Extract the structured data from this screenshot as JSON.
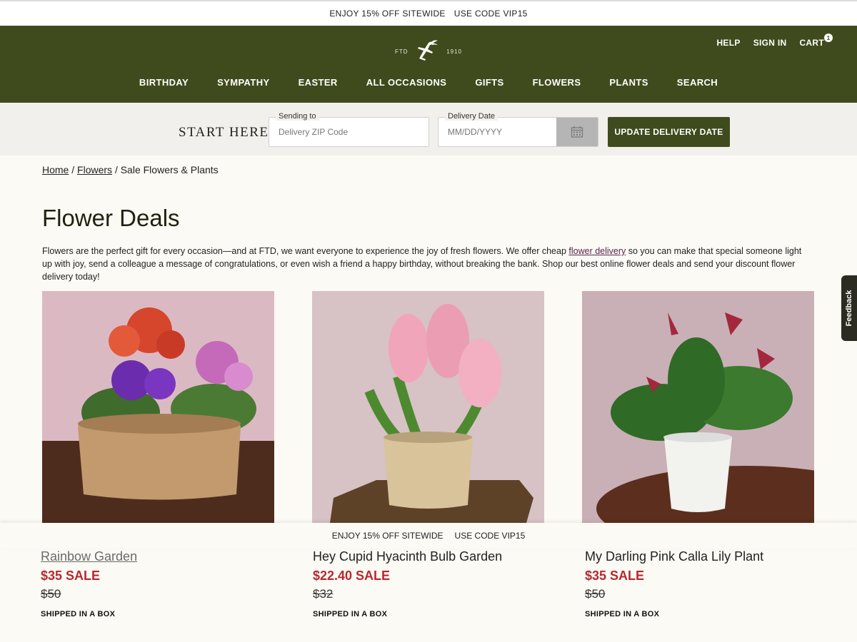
{
  "promo": {
    "text": "ENJOY 15% OFF SITEWIDE",
    "code": "USE CODE  VIP15"
  },
  "logo": {
    "left": "FTD",
    "right": "1910"
  },
  "utility": {
    "help": "HELP",
    "sign_in": "SIGN IN",
    "cart": "CART",
    "cart_count": "1"
  },
  "nav": [
    "BIRTHDAY",
    "SYMPATHY",
    "EASTER",
    "ALL OCCASIONS",
    "GIFTS",
    "FLOWERS",
    "PLANTS",
    "SEARCH"
  ],
  "delivery": {
    "start": "START HERE",
    "zip_label": "Sending to",
    "zip_placeholder": "Delivery ZIP Code",
    "date_label": "Delivery Date",
    "date_placeholder": "MM/DD/YYYY",
    "button": "UPDATE DELIVERY DATE"
  },
  "breadcrumb": {
    "home": "Home",
    "flowers": "Flowers",
    "current": "Sale Flowers & Plants",
    "sep": "/"
  },
  "page": {
    "title": "Flower Deals",
    "intro_before": "Flowers are the perfect gift for every occasion—and at FTD, we want everyone to experience the joy of fresh flowers. We offer cheap ",
    "intro_link": "flower delivery",
    "intro_after": " so you can make that special someone light up with joy, send a colleague a message of congratulations, or even wish a friend a happy birthday, without breaking the bank. Shop our best online flower deals and send your discount flower delivery today!"
  },
  "products": [
    {
      "name": "Rainbow Garden",
      "sale": "$35 SALE",
      "original": "$50",
      "shipping": "SHIPPED IN A BOX"
    },
    {
      "name": "Hey Cupid Hyacinth Bulb Garden",
      "sale": "$22.40 SALE",
      "original": "$32",
      "shipping": "SHIPPED IN A BOX"
    },
    {
      "name": "My Darling Pink Calla Lily Plant",
      "sale": "$35 SALE",
      "original": "$50",
      "shipping": "SHIPPED IN A BOX"
    }
  ],
  "feedback": "Feedback",
  "colors": {
    "brand": "#3f4b1d",
    "sale": "#b8282e",
    "link": "#5a2750"
  }
}
